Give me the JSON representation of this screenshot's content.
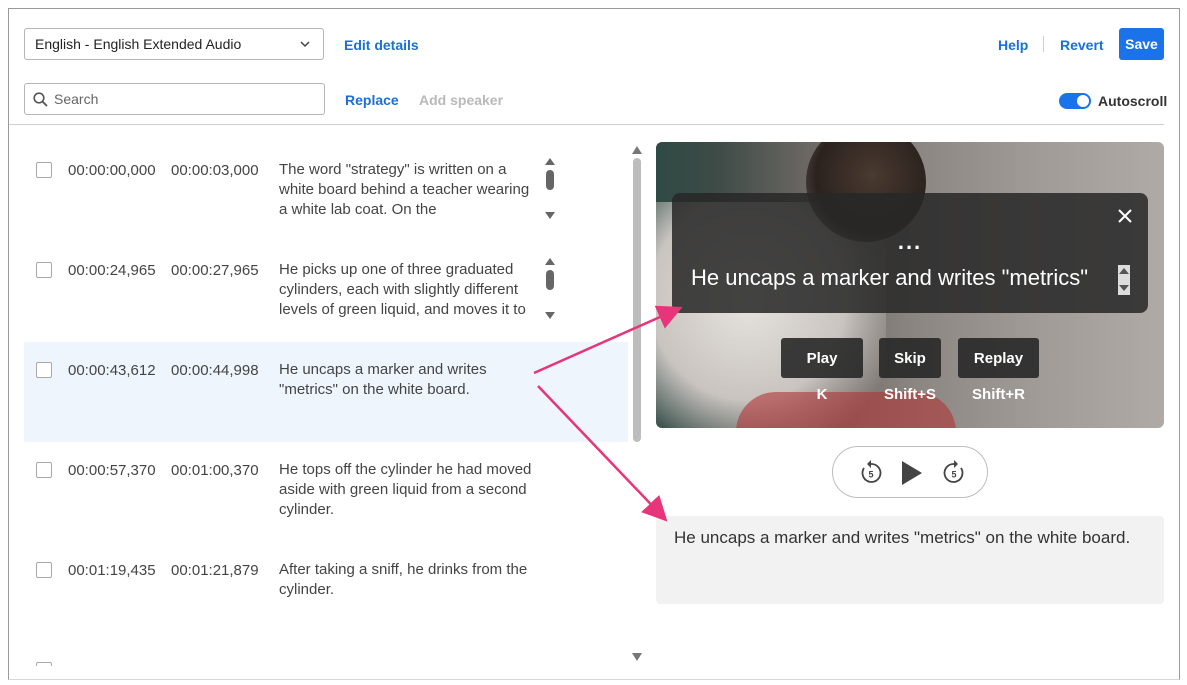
{
  "header": {
    "language_select": "English - English Extended Audio",
    "edit_details": "Edit details",
    "help": "Help",
    "revert": "Revert",
    "save": "Save"
  },
  "toolbar": {
    "search_placeholder": "Search",
    "replace": "Replace",
    "add_speaker": "Add speaker",
    "autoscroll": "Autoscroll",
    "autoscroll_on": true
  },
  "captions": [
    {
      "start": "00:00:00,000",
      "end": "00:00:03,000",
      "text": "The word \"strategy\" is written on a white board behind a teacher wearing a white lab coat. On the"
    },
    {
      "start": "00:00:24,965",
      "end": "00:00:27,965",
      "text": "He picks up one of three graduated cylinders, each with slightly different levels of green liquid, and moves it to"
    },
    {
      "start": "00:00:43,612",
      "end": "00:00:44,998",
      "text": "He uncaps a marker and writes \"metrics\" on the white board.",
      "selected": true
    },
    {
      "start": "00:00:57,370",
      "end": "00:01:00,370",
      "text": "He tops off the cylinder he had moved aside with green liquid from a second cylinder."
    },
    {
      "start": "00:01:19,435",
      "end": "00:01:21,879",
      "text": "After taking a sniff, he drinks from the cylinder."
    }
  ],
  "video": {
    "overlay_dots": "...",
    "caption": "He uncaps a marker and writes \"metrics\"",
    "buttons": [
      {
        "label": "Play",
        "shortcut": "K"
      },
      {
        "label": "Skip",
        "shortcut": "Shift+S"
      },
      {
        "label": "Replay",
        "shortcut": "Shift+R"
      }
    ],
    "controls": [
      "rewind-5-icon",
      "play-icon",
      "forward-5-icon"
    ],
    "rewind_seconds": "5",
    "forward_seconds": "5"
  },
  "description_panel": "He uncaps a marker and writes \"metrics\" on the white board.",
  "colors": {
    "accent": "#1a73e8",
    "selected_row": "#eef5fd",
    "annotation_arrow": "#e8357a"
  }
}
